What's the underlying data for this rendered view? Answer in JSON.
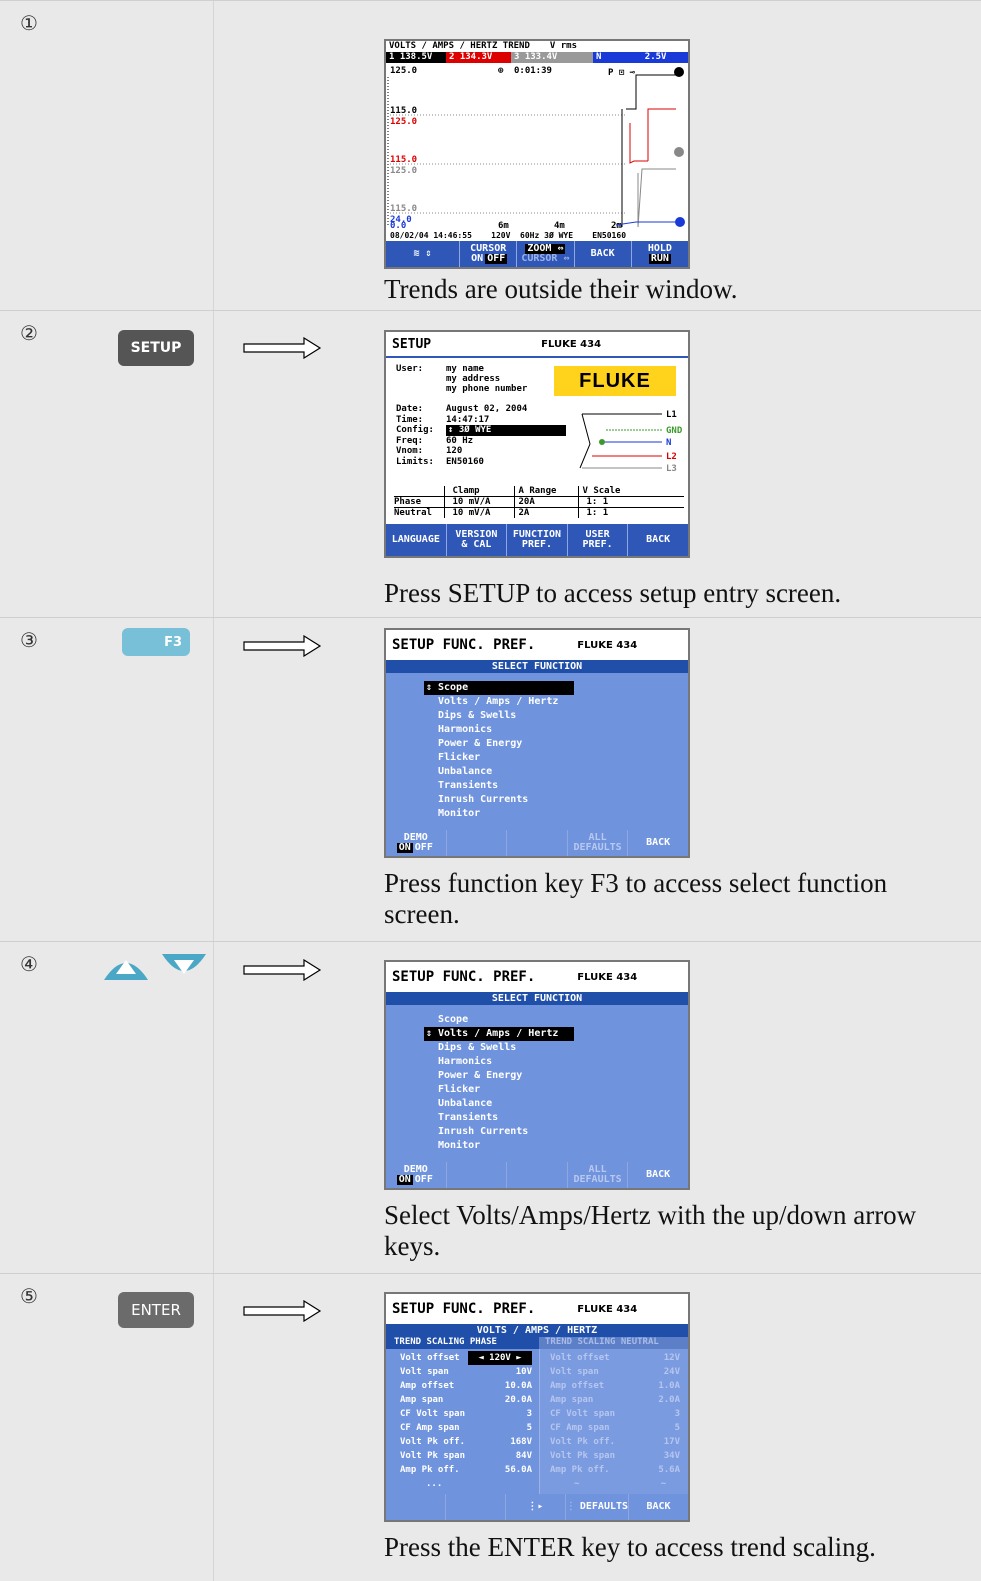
{
  "steps": [
    {
      "num": "①",
      "key": "",
      "caption": "Trends are outside their window."
    },
    {
      "num": "②",
      "key": "SETUP",
      "caption": "Press SETUP to access setup entry screen."
    },
    {
      "num": "③",
      "key": "F3",
      "caption": "Press function key F3 to access select function screen."
    },
    {
      "num": "④",
      "key": "",
      "caption": "Select Volts/Amps/Hertz with the up/down arrow keys."
    },
    {
      "num": "⑤",
      "key": "ENTER",
      "caption": "Press the ENTER key to access trend scaling."
    }
  ],
  "trend": {
    "title": "VOLTS / AMPS / HERTZ TREND",
    "unit": "V rms",
    "ch1": "138.5V",
    "ch2": "134.3V",
    "ch3": "133.4V",
    "chN": "2.5V",
    "time": "0:01:39",
    "labels": [
      {
        "text": "125.0",
        "color": "#000"
      },
      {
        "text": "115.0",
        "color": "#000"
      },
      {
        "text": "125.0",
        "color": "#d00"
      },
      {
        "text": "115.0",
        "color": "#d00"
      },
      {
        "text": "125.0",
        "color": "#888"
      },
      {
        "text": "115.0",
        "color": "#888"
      },
      {
        "text": "24.0",
        "color": "#1a3ad8"
      },
      {
        "text": "0.0",
        "color": "#1a3ad8"
      }
    ],
    "xticks": [
      "6m",
      "4m",
      "2m"
    ],
    "status": "08/02/04 14:46:55    120V  60Hz 3Ø WYE    EN50160",
    "fkeys": {
      "cursor_on": "CURSOR",
      "on": "ON",
      "off": "OFF",
      "zoom": "ZOOM",
      "cursor2": "CURSOR",
      "back": "BACK",
      "hold": "HOLD",
      "run": "RUN"
    }
  },
  "setup": {
    "title": "SETUP",
    "brand": "FLUKE 434",
    "logo": "FLUKE",
    "user_label": "User:",
    "user": [
      "my name",
      "my address",
      "my phone number"
    ],
    "rows": [
      {
        "k": "Date:",
        "v": "August 02, 2004"
      },
      {
        "k": "Time:",
        "v": "14:47:17"
      },
      {
        "k": "Config:",
        "v": "↕ 3Ø WYE"
      },
      {
        "k": "Freq:",
        "v": "60 Hz"
      },
      {
        "k": "Vnom:",
        "v": "120"
      },
      {
        "k": "Limits:",
        "v": "EN50160"
      }
    ],
    "phases": [
      "L1",
      "GND",
      "N",
      "L2",
      "L3"
    ],
    "table_header": [
      "",
      "Clamp",
      "A Range",
      "V Scale"
    ],
    "table_rows": [
      [
        "Phase",
        "10 mV/A",
        "20A",
        "1:  1"
      ],
      [
        "Neutral",
        "10 mV/A",
        "2A",
        "1:  1"
      ]
    ],
    "fkeys": [
      "LANGUAGE",
      "VERSION\n& CAL",
      "FUNCTION\nPREF.",
      "USER\nPREF.",
      "BACK"
    ]
  },
  "func": {
    "title": "SETUP FUNC. PREF.",
    "brand": "FLUKE 434",
    "band": "SELECT FUNCTION",
    "items": [
      "Scope",
      "Volts / Amps / Hertz",
      "Dips & Swells",
      "Harmonics",
      "Power & Energy",
      "Flicker",
      "Unbalance",
      "Transients",
      "Inrush Currents",
      "Monitor"
    ],
    "demo": "DEMO",
    "on": "ON",
    "off": "OFF",
    "all_defaults": "ALL\nDEFAULTS",
    "back": "BACK"
  },
  "vah": {
    "title": "SETUP FUNC. PREF.",
    "brand": "FLUKE 434",
    "band": "VOLTS / AMPS / HERTZ",
    "phase_header": "TREND SCALING PHASE",
    "neutral_header": "TREND SCALING NEUTRAL",
    "phase_rows": [
      [
        "Volt offset",
        "◄ 120V ►"
      ],
      [
        "Volt span",
        "10V"
      ],
      [
        "Amp offset",
        "10.0A"
      ],
      [
        "Amp span",
        "20.0A"
      ],
      [
        "CF Volt span",
        "3"
      ],
      [
        "CF Amp span",
        "5"
      ],
      [
        "Volt Pk off.",
        "168V"
      ],
      [
        "Volt Pk span",
        "84V"
      ],
      [
        "Amp Pk off.",
        "56.0A"
      ]
    ],
    "neutral_rows": [
      [
        "Volt offset",
        "12V"
      ],
      [
        "Volt span",
        "24V"
      ],
      [
        "Amp offset",
        "1.0A"
      ],
      [
        "Amp span",
        "2.0A"
      ],
      [
        "CF Volt span",
        "3"
      ],
      [
        "CF Amp span",
        "5"
      ],
      [
        "Volt Pk off.",
        "17V"
      ],
      [
        "Volt Pk span",
        "34V"
      ],
      [
        "Amp Pk off.",
        "5.6A"
      ]
    ],
    "defaults": "DEFAULTS",
    "back": "BACK"
  }
}
